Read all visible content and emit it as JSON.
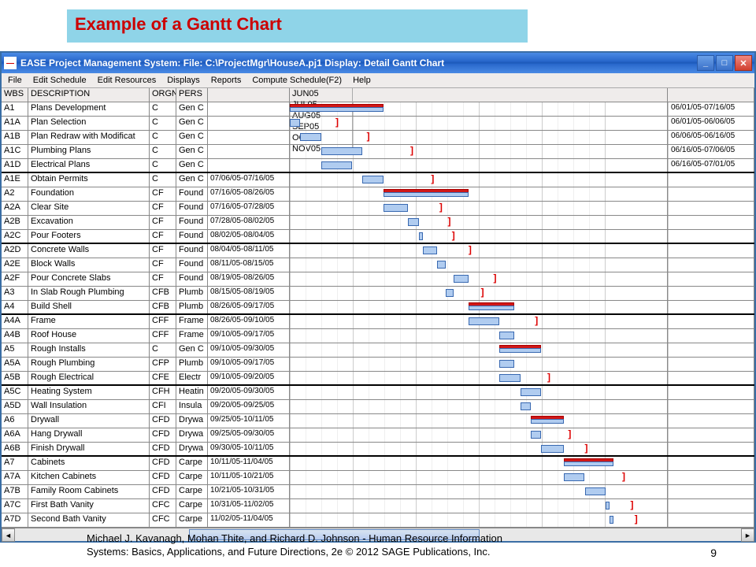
{
  "slide": {
    "title": "Example of a Gantt Chart"
  },
  "window": {
    "title": "EASE Project Management System:  File:  C:\\ProjectMgr\\HouseA.pj1  Display: Detail Gantt Chart",
    "icon_text": "—"
  },
  "menu": [
    "File",
    "Edit Schedule",
    "Edit Resources",
    "Displays",
    "Reports",
    "Compute Schedule(F2)",
    "Help"
  ],
  "columns": {
    "wbs": "WBS",
    "desc": "DESCRIPTION",
    "org": "ORGN",
    "pers": "PERS"
  },
  "months": [
    "JUN05",
    "JUL05",
    "AUG05",
    "SEP05",
    "OCT05",
    "NOV05"
  ],
  "footer_line1": "Michael J. Kavanagh, Mohan Thite, and Richard D. Johnson - Human Resource Information",
  "footer_line2": "Systems: Basics, Applications, and Future Directions, 2e © 2012 SAGE Publications, Inc.",
  "page_number": "9",
  "chart_data": {
    "type": "gantt",
    "timeline_start": "2005-06-01",
    "timeline_end": "2005-11-30",
    "months": [
      "JUN05",
      "JUL05",
      "AUG05",
      "SEP05",
      "OCT05",
      "NOV05"
    ],
    "tasks": [
      {
        "wbs": "A1",
        "desc": "Plans Development",
        "org": "C",
        "pers": "Gen C",
        "right_date": "06/01/05-07/16/05",
        "summary": true,
        "start": 0,
        "end": 45,
        "group_end": false
      },
      {
        "wbs": "A1A",
        "desc": "Plan Selection",
        "org": "C",
        "pers": "Gen C",
        "right_date": "06/01/05-06/06/05",
        "start": 0,
        "end": 5,
        "tick_at": 22,
        "group_end": false
      },
      {
        "wbs": "A1B",
        "desc": "Plan Redraw with Modificat",
        "org": "C",
        "pers": "Gen C",
        "right_date": "06/06/05-06/16/05",
        "start": 5,
        "end": 15,
        "tick_at": 37,
        "group_end": false
      },
      {
        "wbs": "A1C",
        "desc": "Plumbing Plans",
        "org": "C",
        "pers": "Gen C",
        "right_date": "06/16/05-07/06/05",
        "start": 15,
        "end": 35,
        "tick_at": 58,
        "group_end": false
      },
      {
        "wbs": "A1D",
        "desc": "Electrical Plans",
        "org": "C",
        "pers": "Gen C",
        "right_date": "06/16/05-07/01/05",
        "start": 15,
        "end": 30,
        "group_end": true
      },
      {
        "wbs": "A1E",
        "desc": "Obtain Permits",
        "org": "C",
        "pers": "Gen C",
        "dates": "07/06/05-07/16/05",
        "start": 35,
        "end": 45,
        "tick_at": 68,
        "group_end": false
      },
      {
        "wbs": "A2",
        "desc": "Foundation",
        "org": "CF",
        "pers": "Found",
        "dates": "07/16/05-08/26/05",
        "summary": true,
        "start": 45,
        "end": 86,
        "group_end": false
      },
      {
        "wbs": "A2A",
        "desc": "Clear Site",
        "org": "CF",
        "pers": "Found",
        "dates": "07/16/05-07/28/05",
        "start": 45,
        "end": 57,
        "tick_at": 72,
        "group_end": false
      },
      {
        "wbs": "A2B",
        "desc": "Excavation",
        "org": "CF",
        "pers": "Found",
        "dates": "07/28/05-08/02/05",
        "start": 57,
        "end": 62,
        "tick_at": 76,
        "group_end": false
      },
      {
        "wbs": "A2C",
        "desc": "Pour Footers",
        "org": "CF",
        "pers": "Found",
        "dates": "08/02/05-08/04/05",
        "start": 62,
        "end": 64,
        "tick_at": 78,
        "group_end": true
      },
      {
        "wbs": "A2D",
        "desc": "Concrete Walls",
        "org": "CF",
        "pers": "Found",
        "dates": "08/04/05-08/11/05",
        "start": 64,
        "end": 71,
        "tick_at": 86,
        "group_end": false
      },
      {
        "wbs": "A2E",
        "desc": "Block Walls",
        "org": "CF",
        "pers": "Found",
        "dates": "08/11/05-08/15/05",
        "start": 71,
        "end": 75,
        "group_end": false
      },
      {
        "wbs": "A2F",
        "desc": "Pour Concrete Slabs",
        "org": "CF",
        "pers": "Found",
        "dates": "08/19/05-08/26/05",
        "start": 79,
        "end": 86,
        "tick_at": 98,
        "group_end": false
      },
      {
        "wbs": "A3",
        "desc": "In Slab Rough Plumbing",
        "org": "CFB",
        "pers": "Plumb",
        "dates": "08/15/05-08/19/05",
        "start": 75,
        "end": 79,
        "tick_at": 92,
        "group_end": false
      },
      {
        "wbs": "A4",
        "desc": "Build Shell",
        "org": "CFB",
        "pers": "Plumb",
        "dates": "08/26/05-09/17/05",
        "summary": true,
        "start": 86,
        "end": 108,
        "group_end": true
      },
      {
        "wbs": "A4A",
        "desc": "Frame",
        "org": "CFF",
        "pers": "Frame",
        "dates": "08/26/05-09/10/05",
        "start": 86,
        "end": 101,
        "tick_at": 118,
        "group_end": false
      },
      {
        "wbs": "A4B",
        "desc": "Roof House",
        "org": "CFF",
        "pers": "Frame",
        "dates": "09/10/05-09/17/05",
        "start": 101,
        "end": 108,
        "group_end": false
      },
      {
        "wbs": "A5",
        "desc": "Rough Installs",
        "org": "C",
        "pers": "Gen C",
        "dates": "09/10/05-09/30/05",
        "summary": true,
        "start": 101,
        "end": 121,
        "group_end": false
      },
      {
        "wbs": "A5A",
        "desc": "Rough Plumbing",
        "org": "CFP",
        "pers": "Plumb",
        "dates": "09/10/05-09/17/05",
        "start": 101,
        "end": 108,
        "group_end": false
      },
      {
        "wbs": "A5B",
        "desc": "Rough Electrical",
        "org": "CFE",
        "pers": "Electr",
        "dates": "09/10/05-09/20/05",
        "start": 101,
        "end": 111,
        "tick_at": 124,
        "group_end": true
      },
      {
        "wbs": "A5C",
        "desc": "Heating System",
        "org": "CFH",
        "pers": "Heatin",
        "dates": "09/20/05-09/30/05",
        "start": 111,
        "end": 121,
        "group_end": false
      },
      {
        "wbs": "A5D",
        "desc": "Wall Insulation",
        "org": "CFI",
        "pers": "Insula",
        "dates": "09/20/05-09/25/05",
        "start": 111,
        "end": 116,
        "group_end": false
      },
      {
        "wbs": "A6",
        "desc": "Drywall",
        "org": "CFD",
        "pers": "Drywa",
        "dates": "09/25/05-10/11/05",
        "summary": true,
        "start": 116,
        "end": 132,
        "group_end": false
      },
      {
        "wbs": "A6A",
        "desc": "Hang Drywall",
        "org": "CFD",
        "pers": "Drywa",
        "dates": "09/25/05-09/30/05",
        "start": 116,
        "end": 121,
        "tick_at": 134,
        "group_end": false
      },
      {
        "wbs": "A6B",
        "desc": "Finish Drywall",
        "org": "CFD",
        "pers": "Drywa",
        "dates": "09/30/05-10/11/05",
        "start": 121,
        "end": 132,
        "tick_at": 142,
        "group_end": true
      },
      {
        "wbs": "A7",
        "desc": "Cabinets",
        "org": "CFD",
        "pers": "Carpe",
        "dates": "10/11/05-11/04/05",
        "summary": true,
        "start": 132,
        "end": 156,
        "group_end": false
      },
      {
        "wbs": "A7A",
        "desc": "Kitchen Cabinets",
        "org": "CFD",
        "pers": "Carpe",
        "dates": "10/11/05-10/21/05",
        "start": 132,
        "end": 142,
        "tick_at": 160,
        "group_end": false
      },
      {
        "wbs": "A7B",
        "desc": "Family Room Cabinets",
        "org": "CFD",
        "pers": "Carpe",
        "dates": "10/21/05-10/31/05",
        "start": 142,
        "end": 152,
        "group_end": false
      },
      {
        "wbs": "A7C",
        "desc": "First Bath Vanity",
        "org": "CFC",
        "pers": "Carpe",
        "dates": "10/31/05-11/02/05",
        "start": 152,
        "end": 154,
        "tick_at": 164,
        "group_end": false
      },
      {
        "wbs": "A7D",
        "desc": "Second Bath Vanity",
        "org": "CFC",
        "pers": "Carpe",
        "dates": "11/02/05-11/04/05",
        "start": 154,
        "end": 156,
        "tick_at": 166,
        "group_end": false
      }
    ],
    "timeline_days": 182
  }
}
